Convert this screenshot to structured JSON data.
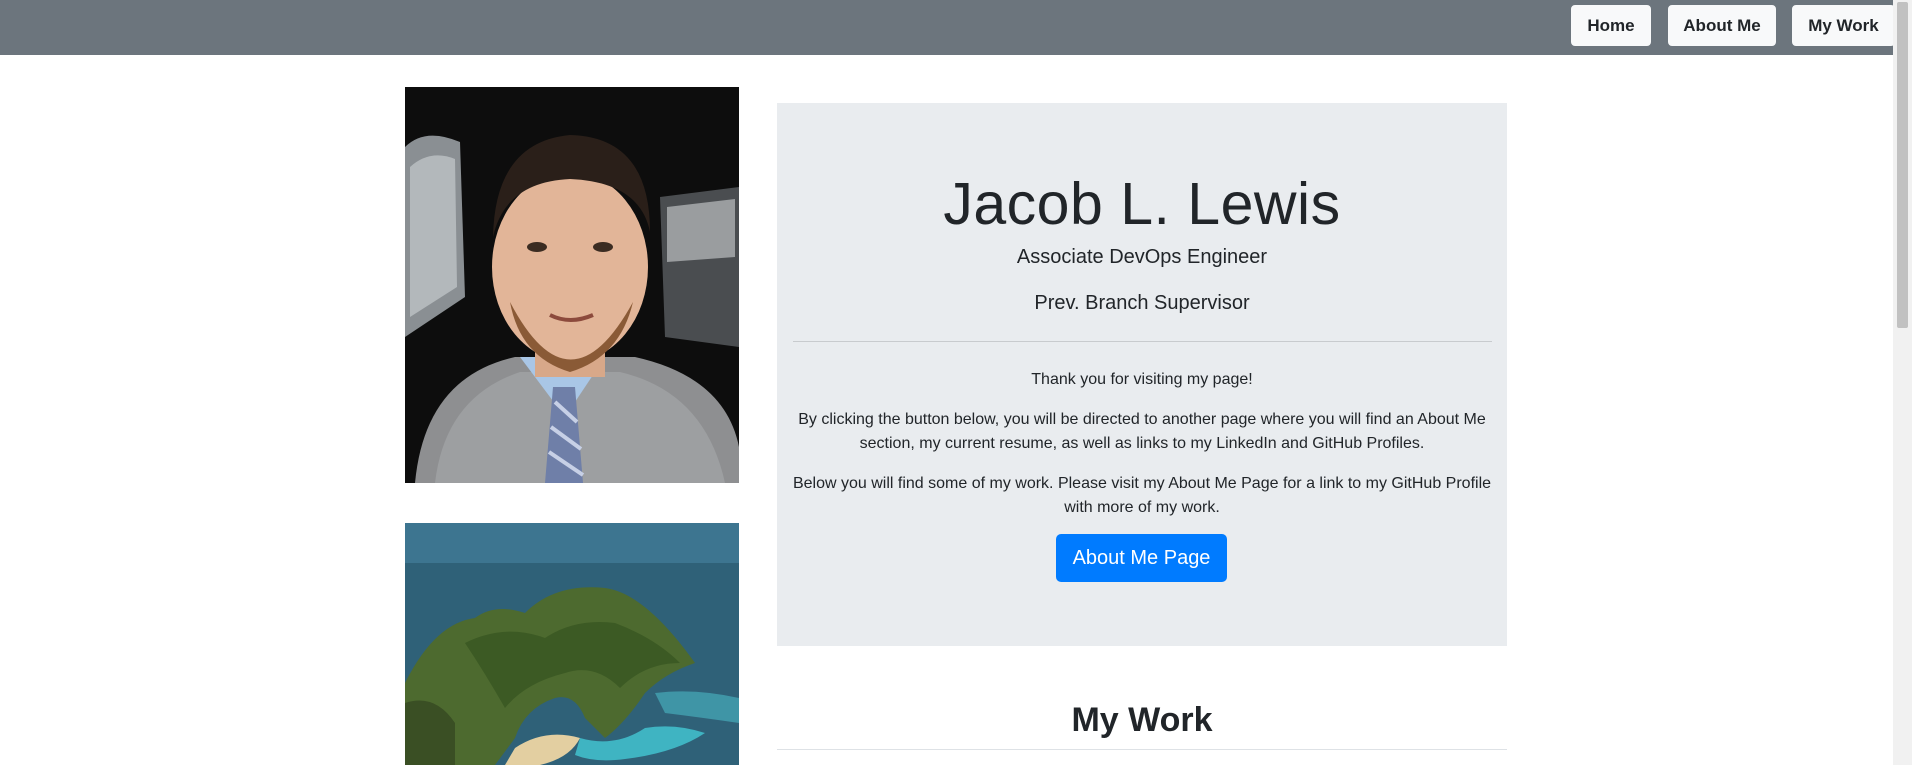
{
  "nav": {
    "items": [
      {
        "label": "Home"
      },
      {
        "label": "About Me"
      },
      {
        "label": "My Work"
      }
    ]
  },
  "hero": {
    "name": "Jacob L. Lewis",
    "title": "Associate DevOps Engineer",
    "previous": "Prev. Branch Supervisor",
    "welcome": "Thank you for visiting my page!",
    "paragraph1": "By clicking the button below, you will be directed to another page where you will find an About Me section, my current resume, as well as links to my LinkedIn and GitHub Profiles.",
    "paragraph2": "Below you will find some of my work. Please visit my About Me Page for a link to my GitHub Profile with more of my work.",
    "button_label": "About Me Page"
  },
  "work": {
    "heading": "My Work"
  },
  "colors": {
    "navbar": "#6c757d",
    "jumbotron": "#e9ecef",
    "primary": "#007bff"
  }
}
